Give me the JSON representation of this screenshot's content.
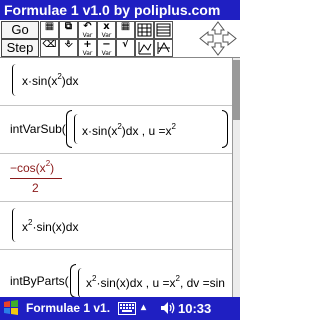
{
  "window": {
    "title": "Formulae 1 v1.0 by poliplus.com"
  },
  "toolbar": {
    "go_label": "Go",
    "step_label": "Step",
    "icons": [
      {
        "name": "new-entry-icon",
        "glyph": "▦",
        "sub": ""
      },
      {
        "name": "copy-icon",
        "glyph": "⧉",
        "sub": ""
      },
      {
        "name": "undo-icon",
        "glyph": "↶",
        "sub": "Var"
      },
      {
        "name": "subscript-icon",
        "glyph": "x",
        "sub": "Var"
      },
      {
        "name": "grid-icon",
        "glyph": "▦",
        "sub": ""
      },
      {
        "name": "delete-icon",
        "glyph": "⌫",
        "sub": ""
      },
      {
        "name": "insert-icon",
        "glyph": "⎀",
        "sub": ""
      },
      {
        "name": "add-var-icon",
        "glyph": "+",
        "sub": "Var"
      },
      {
        "name": "sub-var-icon",
        "glyph": "−",
        "sub": "Var"
      },
      {
        "name": "sqrt-icon",
        "glyph": "√",
        "sub": ""
      }
    ],
    "dpad_icon": "direction-pad-icon"
  },
  "content": {
    "entries": [
      {
        "kind": "input",
        "text_parts": [
          "x·sin(x",
          "2",
          ")dx"
        ]
      },
      {
        "kind": "input",
        "func": "intVarSub(",
        "body": "x·sin(x",
        "sup": "2",
        "tail": ")dx , u =x",
        "sup2": "2"
      },
      {
        "kind": "result",
        "numerator": "−cos(x",
        "numerator_sup": "2",
        "numerator_tail": ")",
        "denominator": "2"
      },
      {
        "kind": "input",
        "text_parts": [
          "x",
          "2",
          "·sin(x)dx"
        ]
      },
      {
        "kind": "input",
        "func": "intByParts(",
        "body": "x",
        "sup": "2",
        "tail": "·sin(x)dx , u =x",
        "sup2": "2",
        "tail2": ", dv =sin"
      }
    ]
  },
  "taskbar": {
    "title": "Formulae 1 v1.",
    "clock": "10:33",
    "start_icon": "windows-start-icon",
    "keyboard_icon": "keyboard-icon",
    "speaker_icon": "speaker-icon"
  },
  "colors": {
    "titlebar": "#1f1fc2",
    "result_text": "#8b1a1a"
  }
}
